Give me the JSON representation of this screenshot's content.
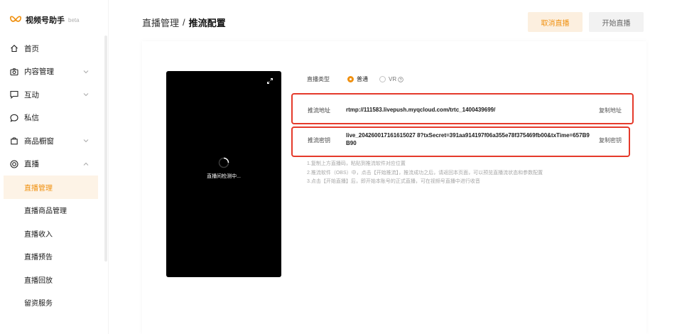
{
  "app": {
    "name": "视频号助手",
    "badge": "beta",
    "logo_color": "#f0900f"
  },
  "sidebar": {
    "items": [
      {
        "label": "首页",
        "icon": "home-icon",
        "expandable": false
      },
      {
        "label": "内容管理",
        "icon": "camera-icon",
        "expandable": true,
        "expanded": false
      },
      {
        "label": "互动",
        "icon": "message-square-icon",
        "expandable": true,
        "expanded": false
      },
      {
        "label": "私信",
        "icon": "chat-bubble-icon",
        "expandable": false
      },
      {
        "label": "商品橱窗",
        "icon": "shopping-bag-icon",
        "expandable": true,
        "expanded": false
      },
      {
        "label": "直播",
        "icon": "live-icon",
        "expandable": true,
        "expanded": true
      }
    ],
    "live_subitems": [
      {
        "label": "直播管理",
        "active": true
      },
      {
        "label": "直播商品管理",
        "active": false
      },
      {
        "label": "直播收入",
        "active": false
      },
      {
        "label": "直播预告",
        "active": false
      },
      {
        "label": "直播回放",
        "active": false
      },
      {
        "label": "留资服务",
        "active": false
      }
    ]
  },
  "header": {
    "breadcrumb_parent": "直播管理",
    "breadcrumb_separator": "/",
    "breadcrumb_current": "推流配置",
    "cancel_button": "取消直播",
    "start_button": "开始直播"
  },
  "preview": {
    "status": "直播间检测中..."
  },
  "config": {
    "type_label": "直播类型",
    "type_options": [
      {
        "label": "普通",
        "selected": true
      },
      {
        "label": "VR",
        "selected": false
      }
    ],
    "url_label": "推流地址",
    "url_value": "rtmp://111583.livepush.myqcloud.com/trtc_1400439699/",
    "url_copy": "复制地址",
    "key_label": "推流密钥",
    "key_value": "live_204260017161615027 8?txSecret=391aa914197f06a355e78f375469fb00&txTime=657B9B90",
    "key_copy": "复制密钥",
    "instructions": [
      "1.复制上方直播码，粘贴到推流软件对应位置",
      "2.推流软件（OBS）中，点击【开始推流】，推流成功之后，请返回本页面，可以预览直播流状态和参数配置",
      "3.点击【开始直播】后，即开始本账号的正式直播，可在视频号直播中进行收音"
    ]
  },
  "colors": {
    "accent": "#f0900f",
    "highlight_border": "#e53a2b",
    "active_bg": "#fdf3e6"
  }
}
